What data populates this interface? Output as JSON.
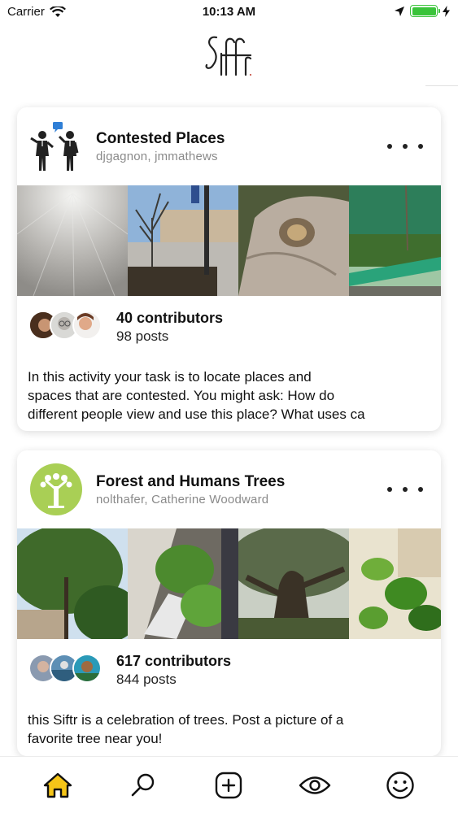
{
  "status_bar": {
    "carrier": "Carrier",
    "time": "10:13 AM"
  },
  "app": {
    "logo_text": "Siftr"
  },
  "cards": [
    {
      "title": "Contested Places",
      "authors": "djgagnon, jmmathews",
      "icon": "people-talking-icon",
      "contributors": "40 contributors",
      "posts": "98 posts",
      "description_lines": [
        "In this activity your task is to locate places and",
        "spaces that are contested. You might ask: How do",
        "different people view and use this place? What uses ca"
      ]
    },
    {
      "title": "Forest and Humans Trees",
      "authors": "nolthafer, Catherine Woodward",
      "icon": "tree-icon",
      "contributors": "617 contributors",
      "posts": "844 posts",
      "description_lines": [
        "this Siftr is a celebration of trees.  Post a picture of a",
        "favorite tree near you!"
      ]
    }
  ],
  "tabbar": {
    "items": [
      "home-icon",
      "search-icon",
      "add-icon",
      "eye-icon",
      "smiley-icon"
    ],
    "active_color": "#f5c518"
  }
}
